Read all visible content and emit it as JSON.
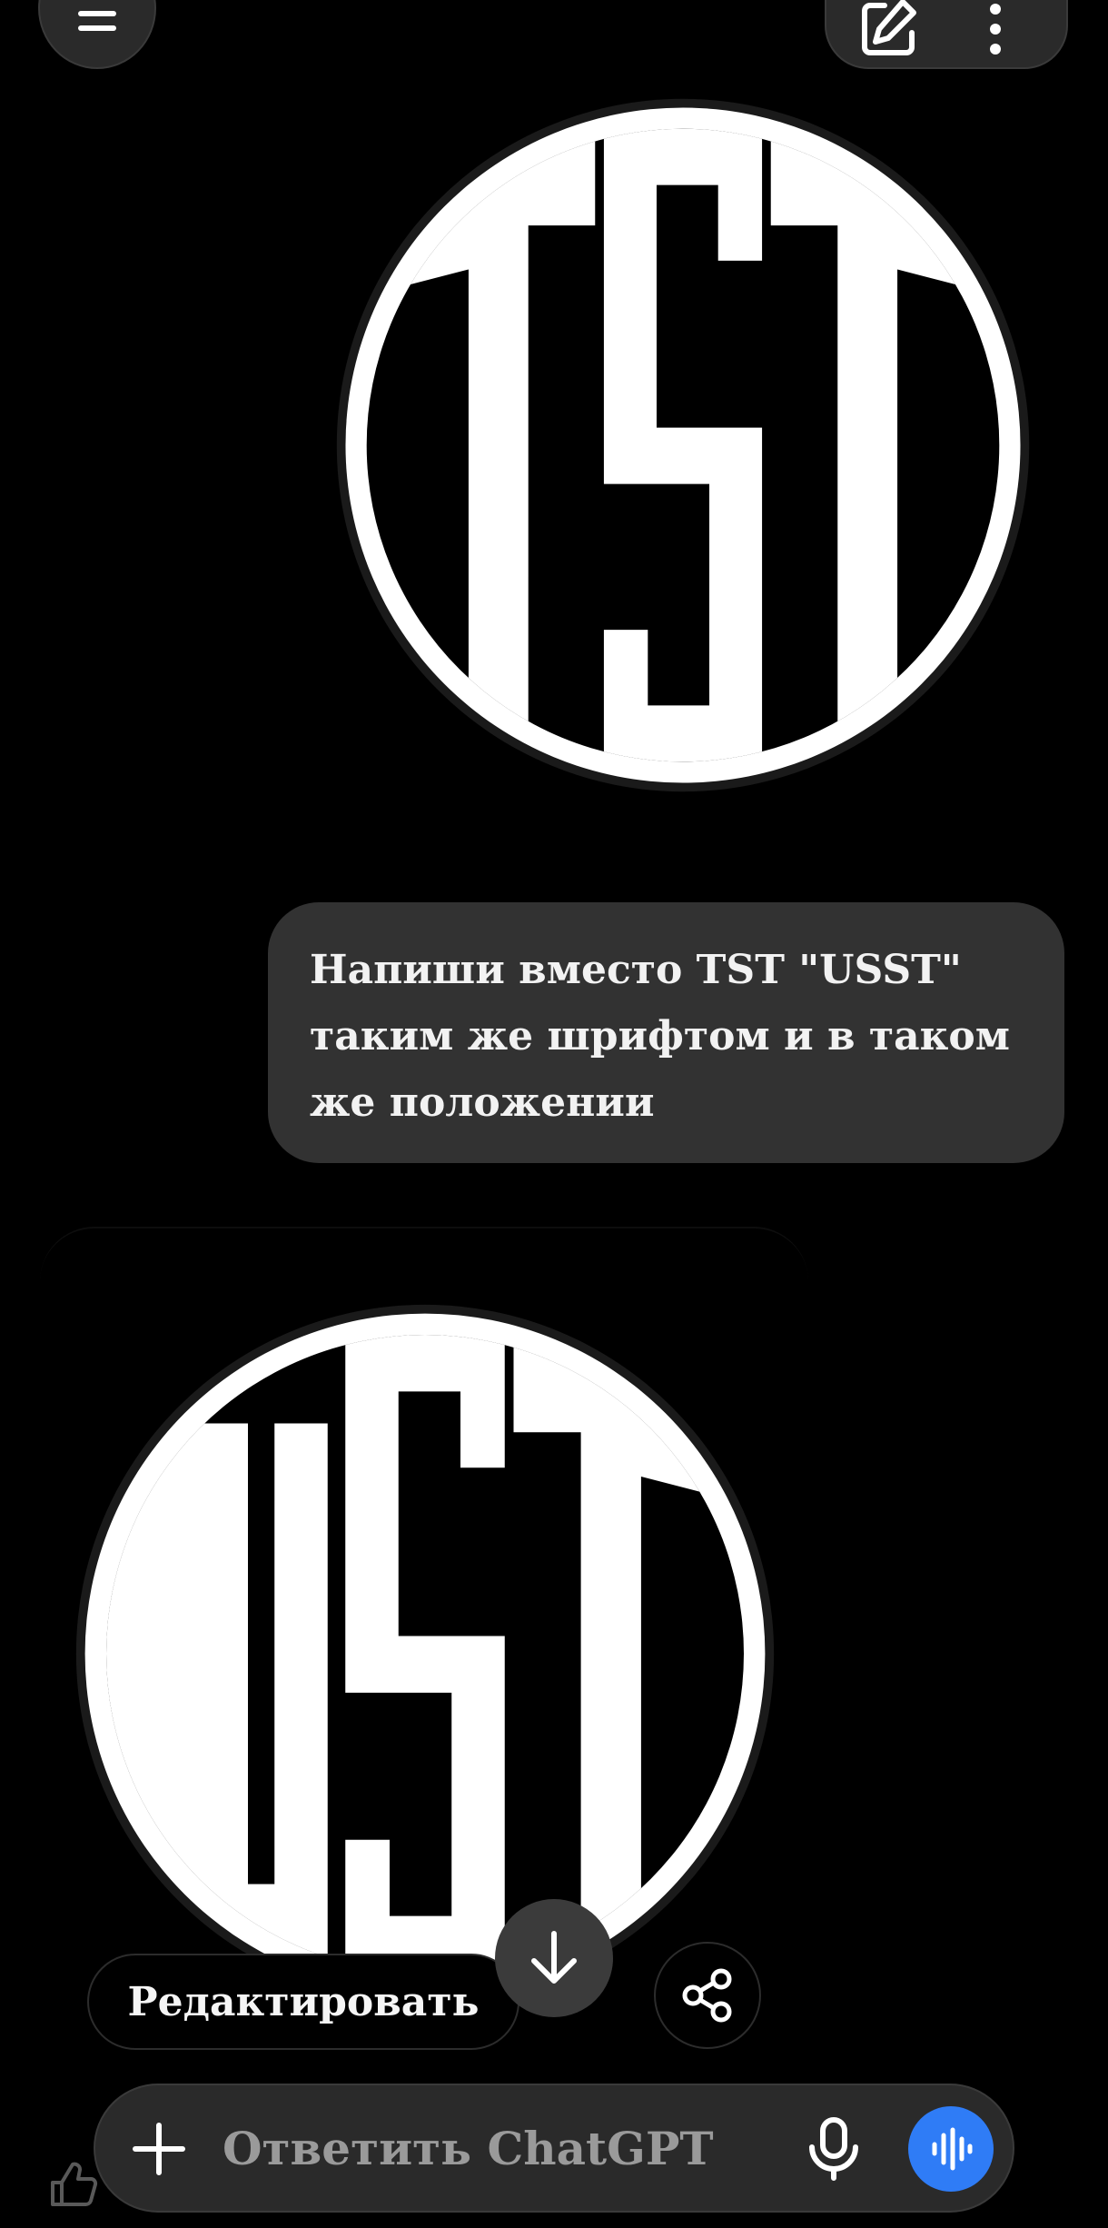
{
  "user_message": {
    "line1": "Напиши вместо TST \"USST\"",
    "line2": "таким же шрифтом и в таком",
    "line3": "же положении"
  },
  "images": {
    "original_logo_text": "TST",
    "generated_logo_text": "UST"
  },
  "actions": {
    "edit_label": "Редактировать"
  },
  "composer": {
    "placeholder": "Ответить ChatGPT"
  },
  "icons": [
    "menu-icon",
    "edit-icon",
    "more-icon",
    "arrow-down-icon",
    "share-icon",
    "plus-icon",
    "mic-icon",
    "voice-mode-icon",
    "like-icon"
  ],
  "colors": {
    "accent": "#2f7cf6",
    "bubble": "#323232",
    "background": "#000000"
  }
}
